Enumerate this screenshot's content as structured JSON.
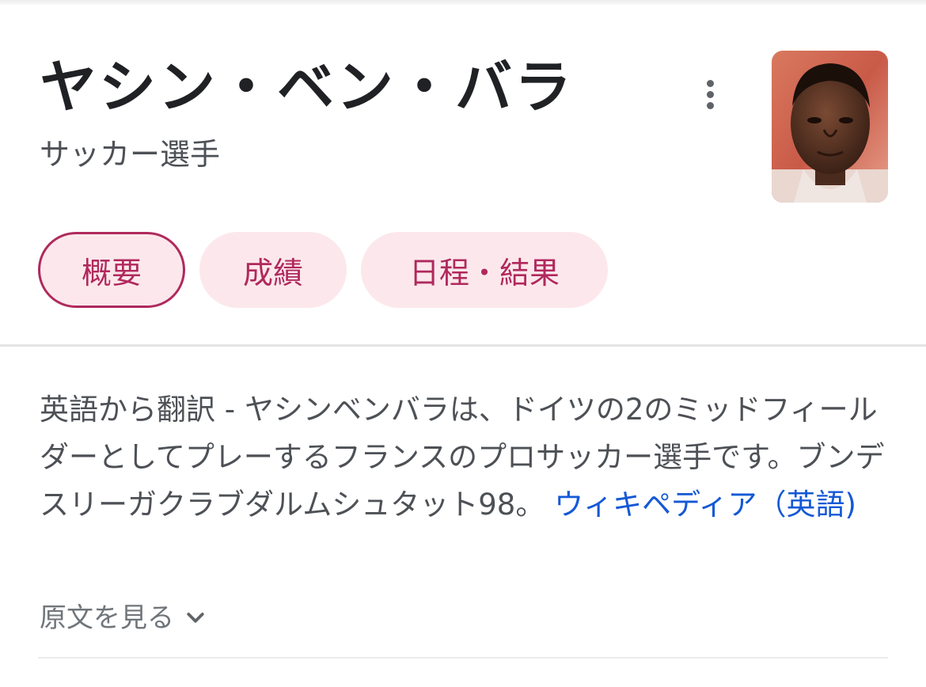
{
  "header": {
    "title": "ヤシン・ベン・バラ",
    "subtitle": "サッカー選手"
  },
  "tabs": [
    {
      "label": "概要",
      "active": true
    },
    {
      "label": "成績",
      "active": false
    },
    {
      "label": "日程・結果",
      "active": false
    }
  ],
  "description": {
    "text": "英語から翻訳 - ヤシンベンバラは、ドイツの2のミッドフィールダーとしてプレーするフランスのプロサッカー選手です。ブンデスリーガクラブダルムシュタット98。 ",
    "source_link": "ウィキペディア（英語)"
  },
  "original_text_toggle": {
    "label": "原文を見る",
    "icon": "chevron-down-icon"
  },
  "icons": {
    "more": "more-vert-icon"
  },
  "colors": {
    "tab_text": "#b0295d",
    "tab_bg": "#fce8ec",
    "link": "#1558d6"
  }
}
